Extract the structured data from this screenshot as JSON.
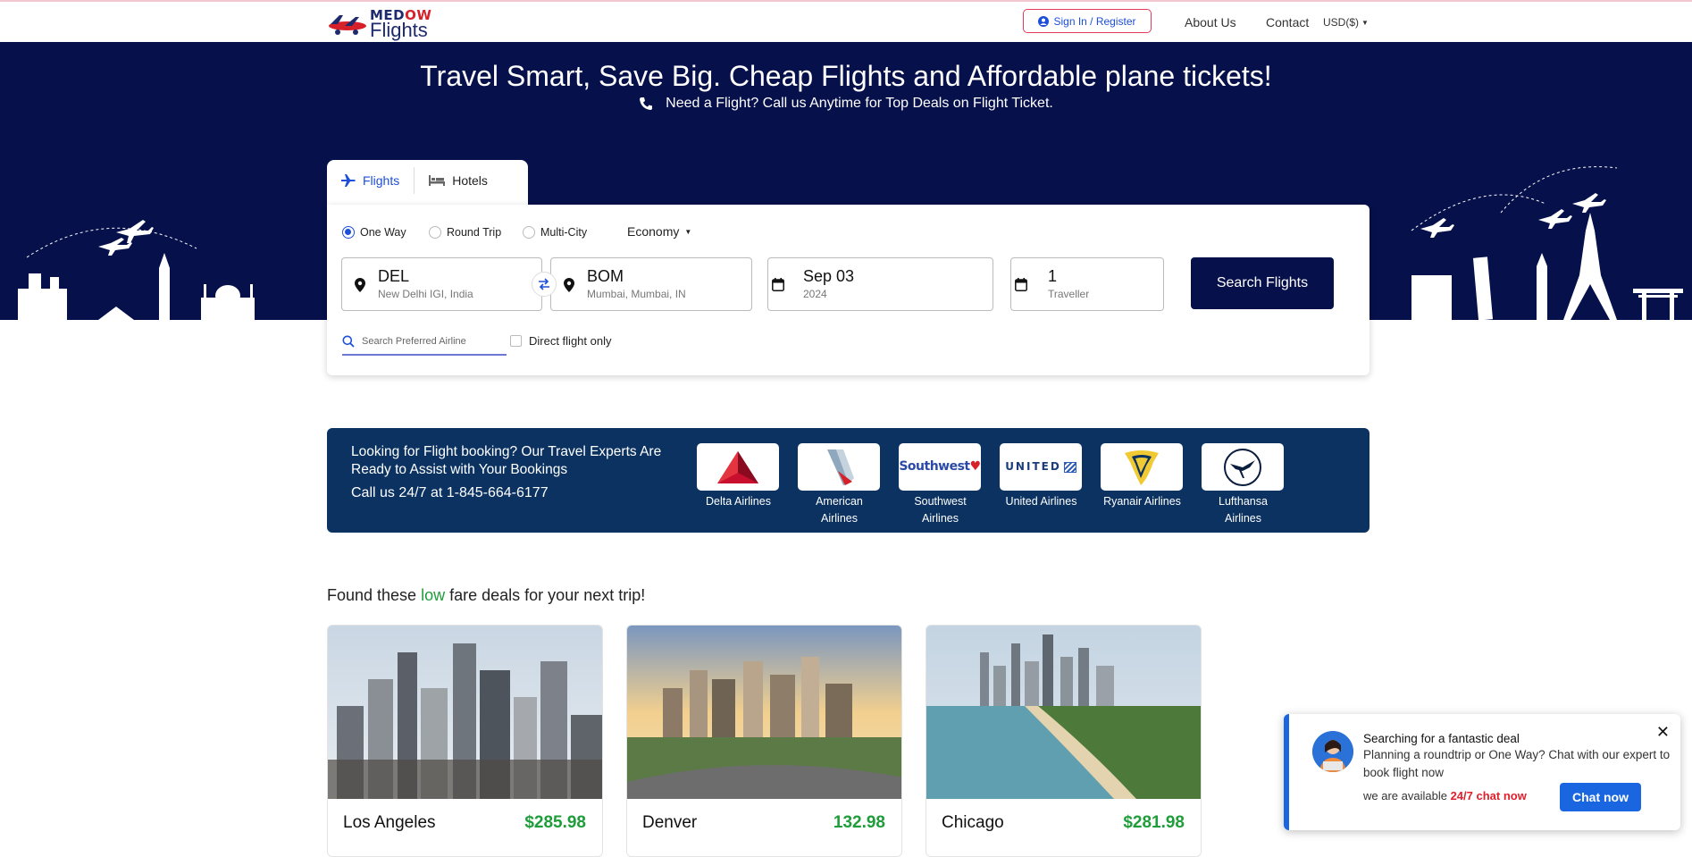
{
  "header": {
    "logo_top_a": "MED",
    "logo_top_b": "OW",
    "logo_bottom": "Flights",
    "signin_label": "Sign In / Register",
    "nav": [
      "About Us",
      "Contact",
      "USD($)"
    ]
  },
  "hero": {
    "title": "Travel Smart, Save Big. Cheap Flights and Affordable plane tickets!",
    "subtitle": "Need a Flight? Call us Anytime for Top Deals on Flight Ticket."
  },
  "search": {
    "tabs": [
      "Flights",
      "Hotels"
    ],
    "trip_types": [
      "One Way",
      "Round Trip",
      "Multi-City"
    ],
    "selected_trip": "One Way",
    "cabin_class": "Economy",
    "from": {
      "code": "DEL",
      "name": "New Delhi IGI, India"
    },
    "to": {
      "code": "BOM",
      "name": "Mumbai, Mumbai, IN"
    },
    "date": {
      "main": "Sep 03",
      "year": "2024"
    },
    "travellers": {
      "count": "1",
      "label": "Traveller"
    },
    "search_button": "Search Flights",
    "airline_placeholder": "Search Preferred Airline",
    "direct_label": "Direct flight only"
  },
  "experts": {
    "text": "Looking for Flight booking? Our Travel Experts Are Ready to Assist with Your Bookings",
    "phone": "Call us 24/7 at 1-845-664-6177",
    "airlines": [
      {
        "name": "Delta Airlines",
        "icon": "delta-logo"
      },
      {
        "name": "American Airlines",
        "icon": "american-logo"
      },
      {
        "name": "Southwest Airlines",
        "icon": "southwest-logo"
      },
      {
        "name": "United Airlines",
        "icon": "united-logo"
      },
      {
        "name": "Ryanair Airlines",
        "icon": "ryanair-logo"
      },
      {
        "name": "Lufthansa Airlines",
        "icon": "lufthansa-logo"
      }
    ]
  },
  "deals": {
    "heading_pre": "Found these",
    "heading_low": "low",
    "heading_post": "fare deals for your next trip!",
    "cards": [
      {
        "city": "Los Angeles",
        "price": "$285.98"
      },
      {
        "city": "Denver",
        "price": "132.98"
      },
      {
        "city": "Chicago",
        "price": "$281.98"
      }
    ]
  },
  "chat": {
    "title": "Searching for a fantastic deal",
    "body": "Planning a roundtrip or One Way? Chat with our expert to book flight now",
    "available_pre": "we are available",
    "available_red": "24/7 chat now",
    "button": "Chat now",
    "close": "✕"
  },
  "colors": {
    "navy": "#06104a",
    "blue_accent": "#1d4fd8",
    "experts_bg": "#0b3260",
    "green_price": "#1f9d3a",
    "chat_blue": "#1a66e0"
  }
}
